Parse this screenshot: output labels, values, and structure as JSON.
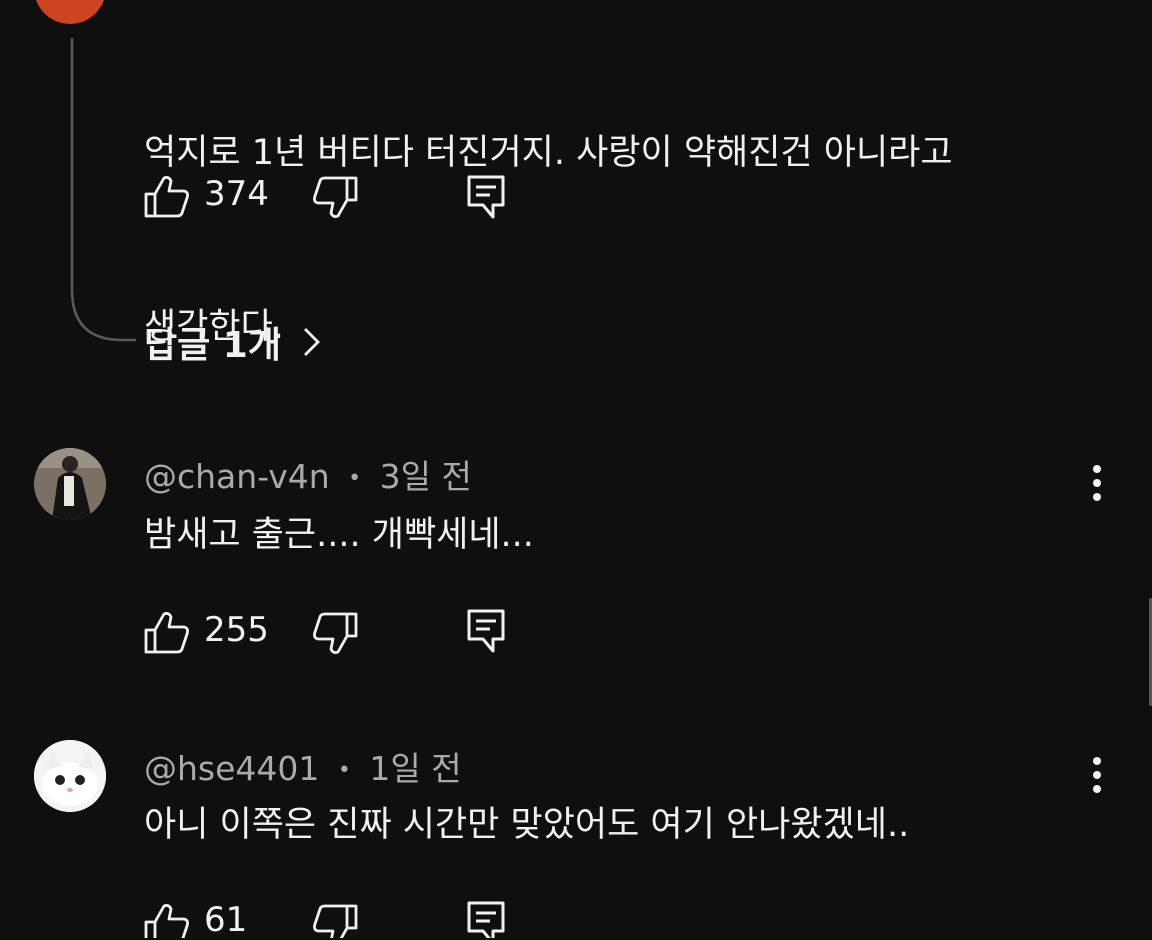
{
  "colors": {
    "background": "#0f0f0f",
    "text": "#f1f1f1",
    "meta": "#aaaaaa",
    "avatar_accent": "#cc4422"
  },
  "comments": [
    {
      "text_lines": [
        "억지로 1년 버티다 터진거지. 사랑이 약해진건 아니라고",
        "생각한다."
      ],
      "likes": "374",
      "replies_label": "답글 1개"
    },
    {
      "author": "@chan-v4n",
      "separator": "•",
      "time": "3일 전",
      "text": "밤새고 출근.... 개빡세네...",
      "likes": "255"
    },
    {
      "author": "@hse4401",
      "separator": "•",
      "time": "1일 전",
      "text": "아니 이쪽은 진짜 시간만 맞았어도 여기 안나왔겠네..",
      "likes": "61"
    }
  ],
  "icons": [
    "like-icon",
    "dislike-icon",
    "reply-icon",
    "more-vert-icon",
    "chevron-right-icon"
  ]
}
